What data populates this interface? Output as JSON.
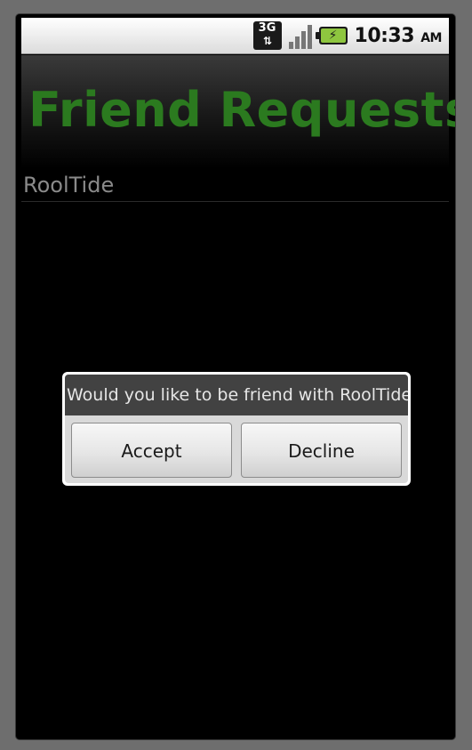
{
  "status_bar": {
    "network_label": "3G",
    "time": "10:33",
    "ampm": "AM",
    "icons": [
      "network-3g-icon",
      "signal-strength-icon",
      "battery-charging-icon"
    ]
  },
  "header": {
    "title": "Friend Requests",
    "title_color": "#2b7a1f"
  },
  "list": {
    "items": [
      {
        "label": "RoolTide"
      }
    ]
  },
  "dialog": {
    "message": "Would you like to be friend with RoolTide",
    "accept_label": "Accept",
    "decline_label": "Decline"
  }
}
